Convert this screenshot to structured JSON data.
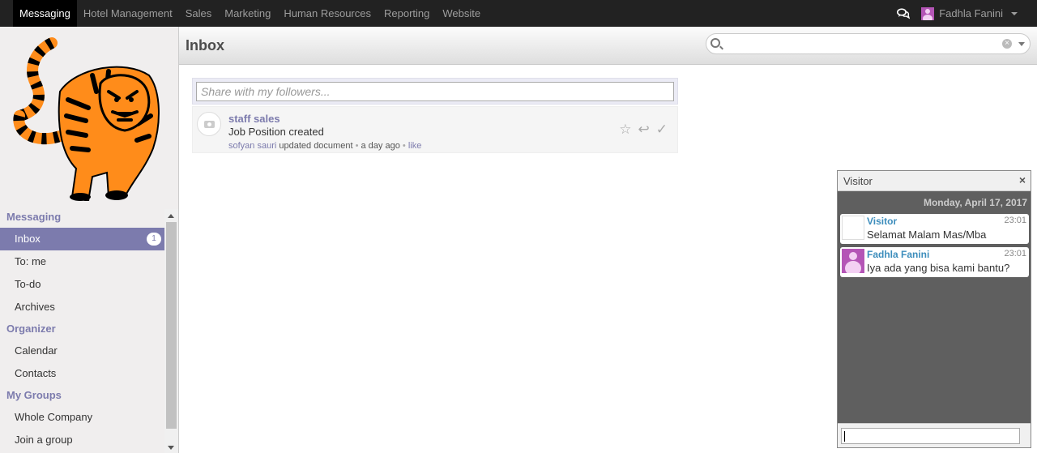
{
  "topnav": {
    "items": [
      {
        "label": "Messaging",
        "active": true
      },
      {
        "label": "Hotel Management"
      },
      {
        "label": "Sales"
      },
      {
        "label": "Marketing"
      },
      {
        "label": "Human Resources"
      },
      {
        "label": "Reporting"
      },
      {
        "label": "Website"
      }
    ],
    "user_name": "Fadhla Fanini"
  },
  "header": {
    "title": "Inbox",
    "search_placeholder": ""
  },
  "sidebar": {
    "logo_icon": "tiger-logo",
    "sections": [
      {
        "heading": "Messaging",
        "items": [
          {
            "label": "Inbox",
            "badge": "1",
            "active": true
          },
          {
            "label": "To: me"
          },
          {
            "label": "To-do"
          },
          {
            "label": "Archives"
          }
        ]
      },
      {
        "heading": "Organizer",
        "items": [
          {
            "label": "Calendar"
          },
          {
            "label": "Contacts"
          }
        ]
      },
      {
        "heading": "My Groups",
        "items": [
          {
            "label": "Whole Company"
          },
          {
            "label": "Join a group"
          }
        ]
      }
    ]
  },
  "composer": {
    "placeholder": "Share with my followers..."
  },
  "message": {
    "title": "staff sales",
    "body": "Job Position created",
    "author": "sofyan sauri",
    "action": "updated document",
    "time": "a day ago",
    "like": "like"
  },
  "chat": {
    "title": "Visitor",
    "close": "×",
    "date": "Monday, April 17, 2017",
    "messages": [
      {
        "name": "Visitor",
        "time": "23:01",
        "text": "Selamat Malam Mas/Mba"
      },
      {
        "name": "Fadhla Fanini",
        "time": "23:01",
        "text": "Iya ada yang bisa kami bantu?"
      }
    ]
  },
  "colors": {
    "topbar": "#222222",
    "accent": "#7c7bad",
    "chat_bg": "#5f5f5f",
    "tiger_orange": "#ff8c1a"
  }
}
